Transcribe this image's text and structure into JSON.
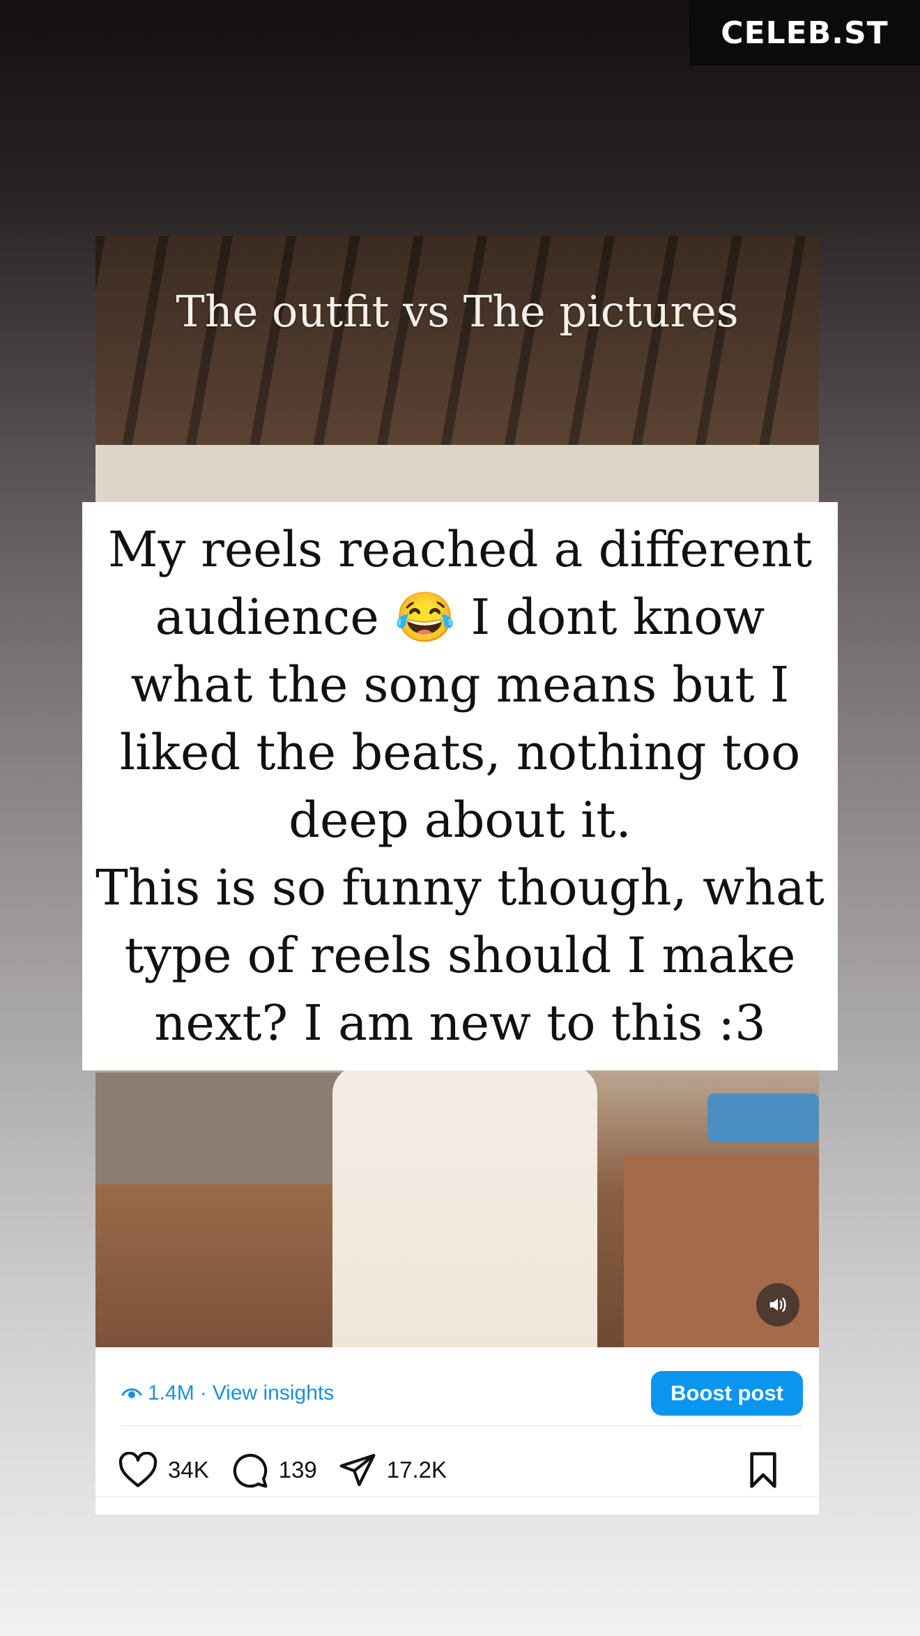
{
  "brand": {
    "name": "CELEB.ST"
  },
  "video": {
    "overlay_title": "The outfit vs The pictures"
  },
  "caption": {
    "text": "My reels reached a different audience 😂  I dont know what the song means but I liked the beats, nothing too deep about it.\nThis is so funny though, what type of reels should I make next? I am new to this :3"
  },
  "insights": {
    "views": "1.4M",
    "separator": "·",
    "link": "View insights"
  },
  "boost": {
    "label": "Boost post"
  },
  "actions": {
    "likes": "34K",
    "comments": "139",
    "shares": "17.2K"
  },
  "icons": {
    "views": "eye-icon",
    "sound": "speaker-icon",
    "like": "heart-icon",
    "comment": "comment-bubble-icon",
    "share": "paper-plane-icon",
    "save": "bookmark-icon"
  },
  "colors": {
    "link_blue": "#1a8fe0",
    "boost_blue": "#0a95f0"
  }
}
